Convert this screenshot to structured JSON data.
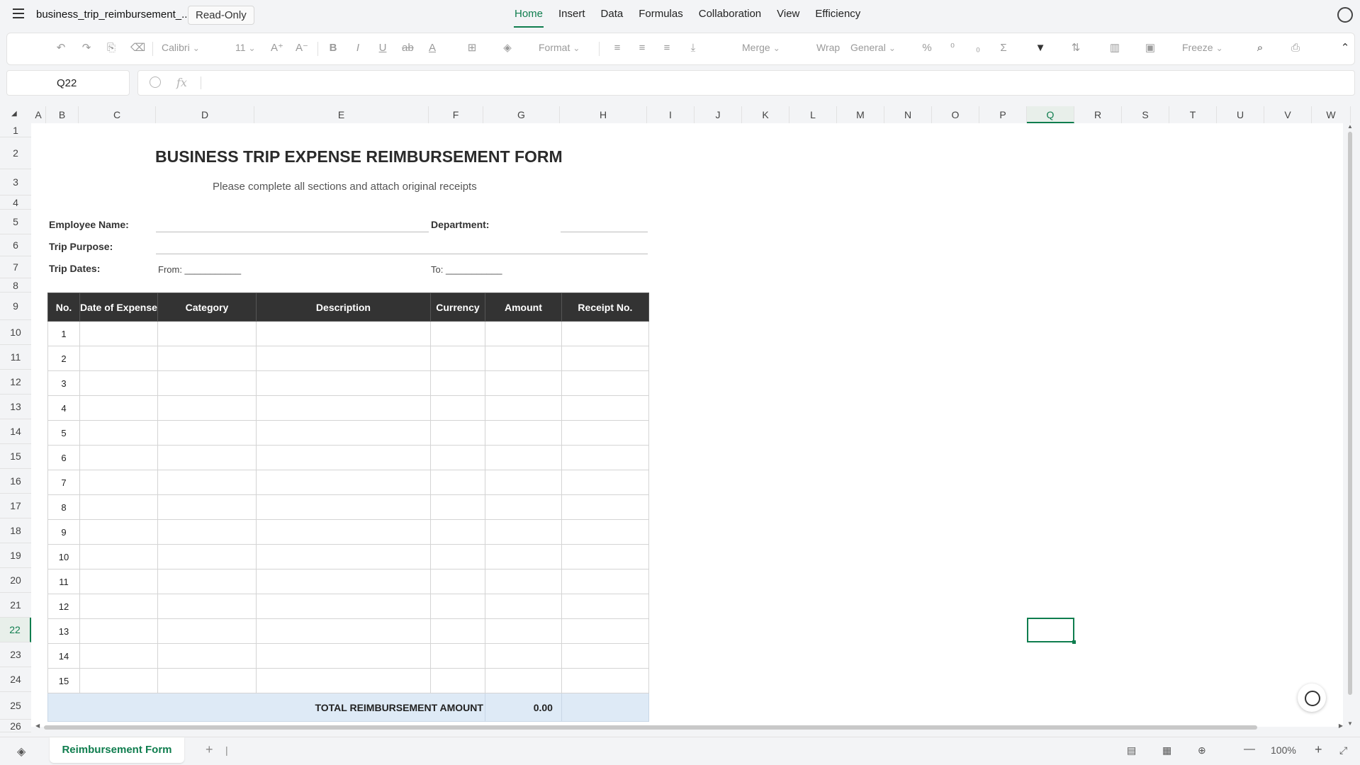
{
  "app": {
    "doc_title": "business_trip_reimbursement_...",
    "readonly_label": "Read-Only",
    "menu_tabs": [
      "Home",
      "Insert",
      "Data",
      "Formulas",
      "Collaboration",
      "View",
      "Efficiency"
    ],
    "active_tab": "Home"
  },
  "toolbar": {
    "font_name": "Calibri",
    "font_size": "11",
    "format_label": "Format",
    "merge_label": "Merge",
    "wrap_label": "Wrap",
    "number_format": "General",
    "freeze_label": "Freeze"
  },
  "formula_bar": {
    "cell_ref": "Q22",
    "fx_label": "fx",
    "formula": ""
  },
  "grid": {
    "columns": [
      "A",
      "B",
      "C",
      "D",
      "E",
      "F",
      "G",
      "H",
      "I",
      "J",
      "K",
      "L",
      "M",
      "N",
      "O",
      "P",
      "Q",
      "R",
      "S",
      "T",
      "U",
      "V",
      "W"
    ],
    "selected_column": "Q",
    "rows": [
      "1",
      "2",
      "3",
      "4",
      "5",
      "6",
      "7",
      "8",
      "9",
      "10",
      "11",
      "12",
      "13",
      "14",
      "15",
      "16",
      "17",
      "18",
      "19",
      "20",
      "21",
      "22",
      "23",
      "24",
      "25",
      "26"
    ],
    "selected_row": "22"
  },
  "form": {
    "title": "BUSINESS TRIP EXPENSE REIMBURSEMENT FORM",
    "subtitle": "Please complete all sections and attach original receipts",
    "employee_name_label": "Employee Name:",
    "department_label": "Department:",
    "trip_purpose_label": "Trip Purpose:",
    "trip_dates_label": "Trip Dates:",
    "from_label": "From: ___________",
    "to_label": "To: ___________",
    "headers": [
      "No.",
      "Date of Expense",
      "Category",
      "Description",
      "Currency",
      "Amount",
      "Receipt No."
    ],
    "row_numbers": [
      "1",
      "2",
      "3",
      "4",
      "5",
      "6",
      "7",
      "8",
      "9",
      "10",
      "11",
      "12",
      "13",
      "14",
      "15"
    ],
    "total_label": "TOTAL REIMBURSEMENT AMOUNT",
    "total_value": "0.00"
  },
  "bottom": {
    "sheet_tab": "Reimbursement Form",
    "zoom": "100%"
  },
  "colors": {
    "accent": "#0f7d4e",
    "header_bg": "#333333",
    "total_bg": "#deeaf6"
  }
}
